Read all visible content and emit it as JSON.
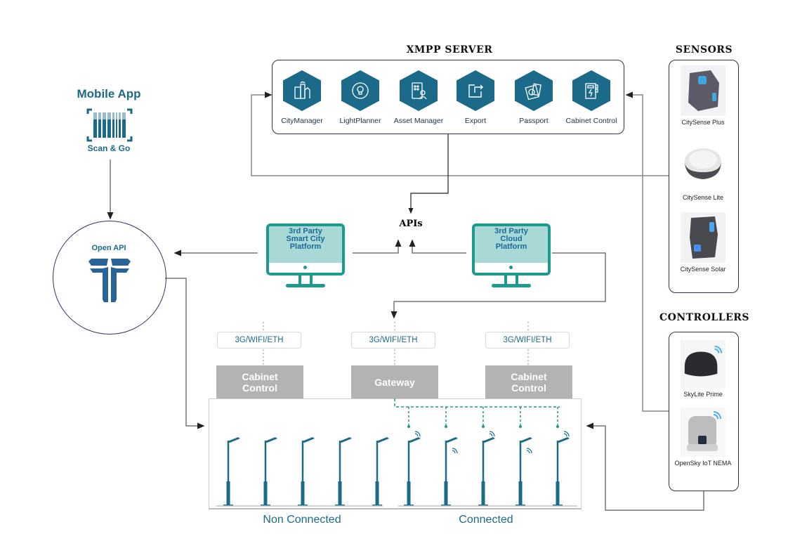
{
  "xmpp_server": {
    "title": "XMPP SERVER",
    "apps": [
      {
        "label": "CityManager",
        "icon": "city-buildings-icon"
      },
      {
        "label": "LightPlanner",
        "icon": "lightbulb-cycle-icon"
      },
      {
        "label": "Asset Manager",
        "icon": "tablet-user-icon"
      },
      {
        "label": "Export",
        "icon": "export-arrow-icon"
      },
      {
        "label": "Passport",
        "icon": "passport-icon"
      },
      {
        "label": "Cabinet Control",
        "icon": "cabinet-bolt-icon"
      }
    ]
  },
  "sensors": {
    "title": "SENSORS",
    "items": [
      {
        "label": "CitySense Plus"
      },
      {
        "label": "CitySense Lite"
      },
      {
        "label": "CitySense Solar"
      }
    ]
  },
  "controllers": {
    "title": "CONTROLLERS",
    "items": [
      {
        "label": "SkyLite Prime"
      },
      {
        "label": "OpenSky IoT NEMA"
      }
    ]
  },
  "mobile_app": {
    "title": "Mobile App",
    "subtitle": "Scan & Go"
  },
  "open_api": {
    "label": "Open API"
  },
  "apis": {
    "label": "APIs"
  },
  "platforms": {
    "smart_city": {
      "line1": "3rd Party",
      "line2": "Smart City",
      "line3": "Platform"
    },
    "cloud": {
      "line1": "3rd Party",
      "line2": "Cloud",
      "line3": "Platform"
    }
  },
  "network": {
    "links": [
      "3G/WIFI/ETH",
      "3G/WIFI/ETH",
      "3G/WIFI/ETH"
    ],
    "nodes": [
      {
        "line1": "Cabinet",
        "line2": "Control"
      },
      {
        "line1": "Gateway",
        "line2": ""
      },
      {
        "line1": "Cabinet",
        "line2": "Control"
      }
    ]
  },
  "streetlights": {
    "non_connected_label": "Non Connected",
    "connected_label": "Connected",
    "non_connected_count": 5,
    "connected_count": 5
  },
  "colors": {
    "brand_blue": "#1b6a8a",
    "teal": "#1c9a8c",
    "panel_border": "#2e3350",
    "wire": "#7a7a7a",
    "node_gray": "#b3b3b3"
  }
}
